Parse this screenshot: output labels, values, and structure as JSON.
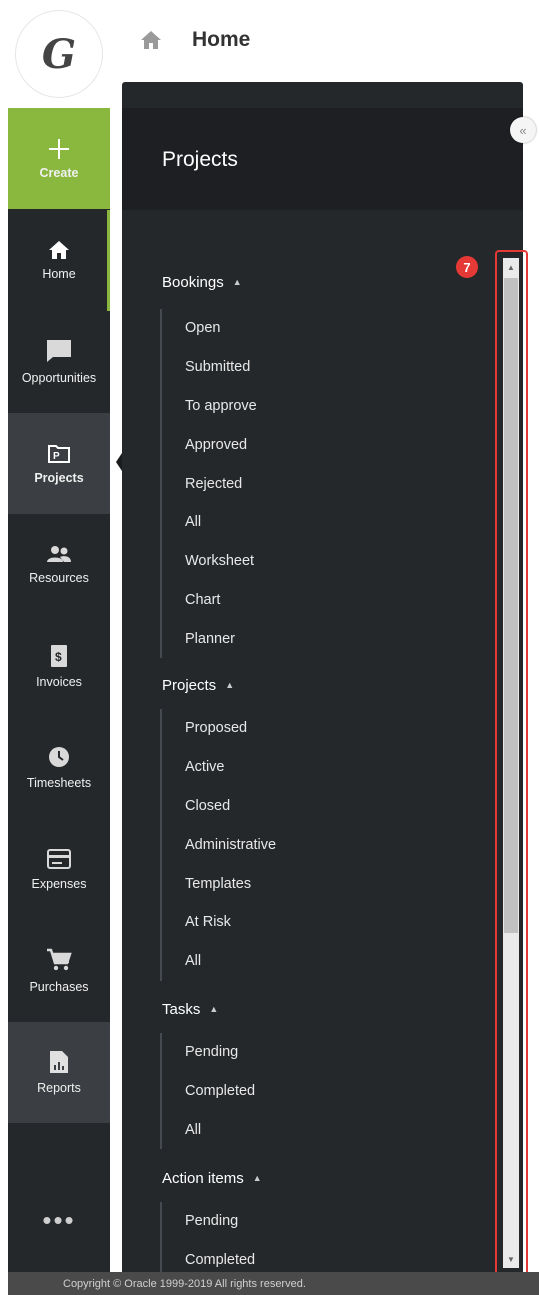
{
  "topbar": {
    "title": "Home"
  },
  "logo": {
    "letter": "G"
  },
  "nav": {
    "create": "Create",
    "home": "Home",
    "opportunities": "Opportunities",
    "projects": "Projects",
    "resources": "Resources",
    "invoices": "Invoices",
    "timesheets": "Timesheets",
    "expenses": "Expenses",
    "purchases": "Purchases",
    "reports": "Reports",
    "more": "•••"
  },
  "flyout": {
    "title": "Projects",
    "collapse_label": "«",
    "sections": {
      "bookings": {
        "label": "Bookings",
        "items": [
          "Open",
          "Submitted",
          "To approve",
          "Approved",
          "Rejected",
          "All",
          "Worksheet",
          "Chart",
          "Planner"
        ]
      },
      "projects": {
        "label": "Projects",
        "items": [
          "Proposed",
          "Active",
          "Closed",
          "Administrative",
          "Templates",
          "At Risk",
          "All"
        ]
      },
      "tasks": {
        "label": "Tasks",
        "items": [
          "Pending",
          "Completed",
          "All"
        ]
      },
      "action_items": {
        "label": "Action items",
        "items": [
          "Pending",
          "Completed"
        ]
      }
    }
  },
  "annotation": {
    "badge": "7",
    "color": "#e53935"
  },
  "footer": {
    "text": "Copyright © Oracle 1999-2019 All rights reserved."
  },
  "colors": {
    "accent": "#8ab83f",
    "nav_bg": "#25282b",
    "highlight": "#e53935"
  }
}
